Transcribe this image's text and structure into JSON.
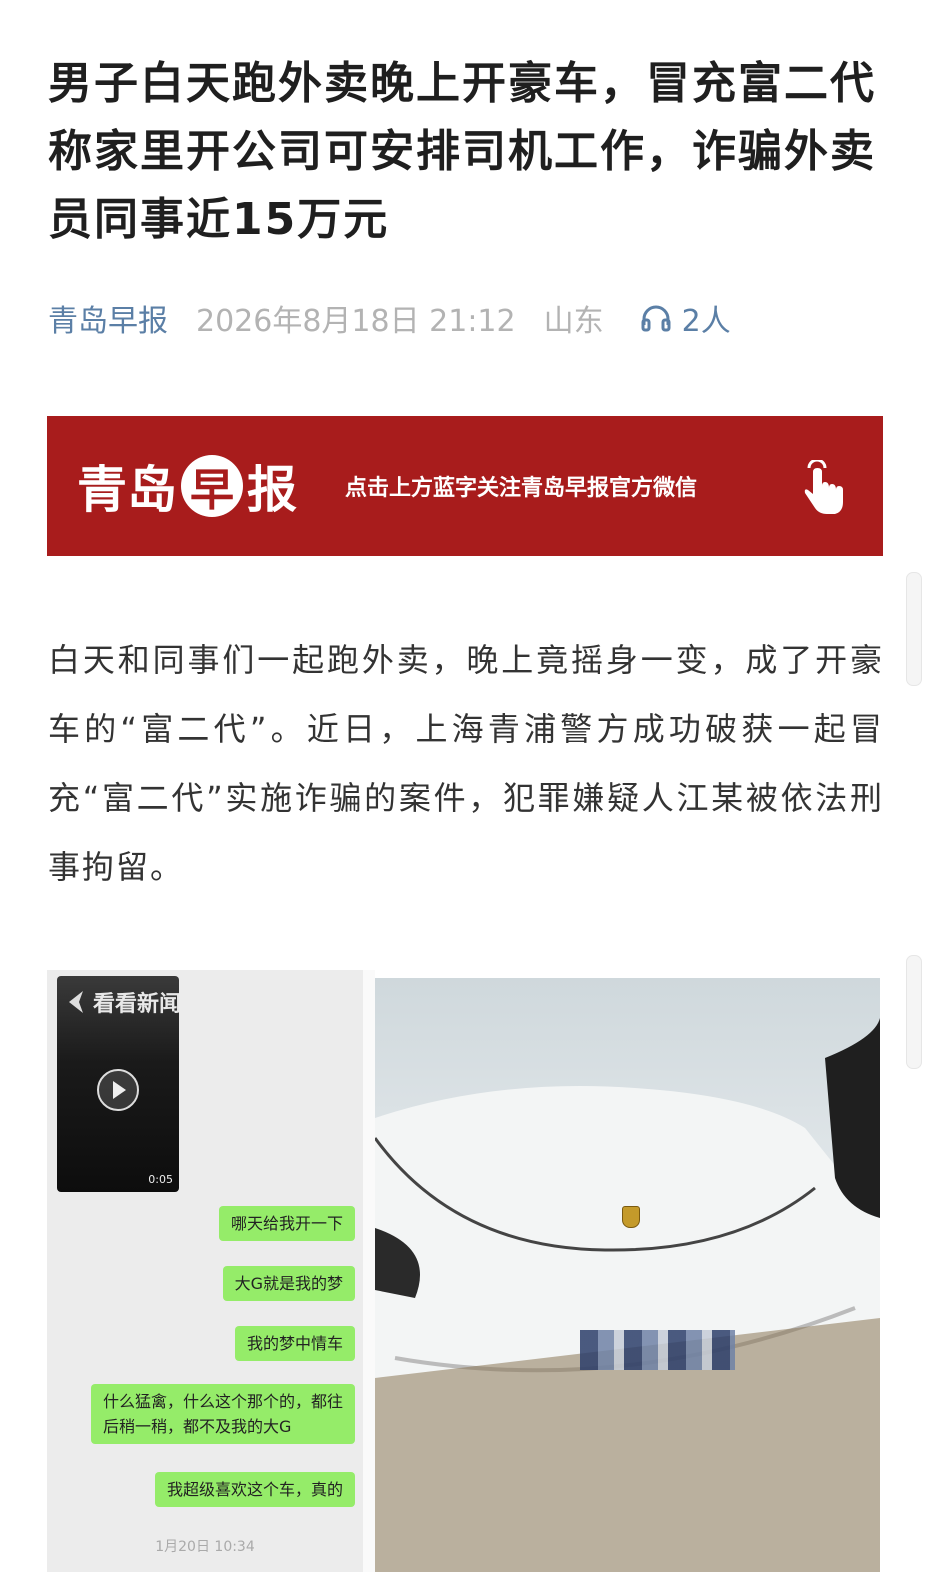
{
  "article": {
    "title": "男子白天跑外卖晚上开豪车，冒充富二代称家里开公司可安排司机工作，诈骗外卖员同事近15万元",
    "meta": {
      "source": "青岛早报",
      "datetime": "2026年8月18日 21:12",
      "location": "山东",
      "listeners": "2人"
    },
    "banner": {
      "logo_left": "青岛",
      "logo_circle": "早",
      "logo_right": "报",
      "slogan": "点击上方蓝字关注青岛早报官方微信"
    },
    "paragraph": "白天和同事们一起跑外卖，晚上竟摇身一变，成了开豪车的“富二代”。近日，上海青浦警方成功破获一起冒充“富二代”实施诈骗的案件，犯罪嫌疑人江某被依法刑事拘留。"
  },
  "image": {
    "video": {
      "watermark": "看看新闻",
      "duration": "0:05"
    },
    "messages": [
      "哪天给我开一下",
      "大G就是我的梦",
      "我的梦中情车",
      "什么猛禽，什么这个那个的，都往\n后稍一稍，都不及我的大G",
      "我超级喜欢这个车，真的"
    ],
    "timestamp": "1月20日 10:34"
  },
  "colors": {
    "banner": "#a81c1c",
    "link": "#5b7fa6",
    "bubble": "#95ec69"
  }
}
